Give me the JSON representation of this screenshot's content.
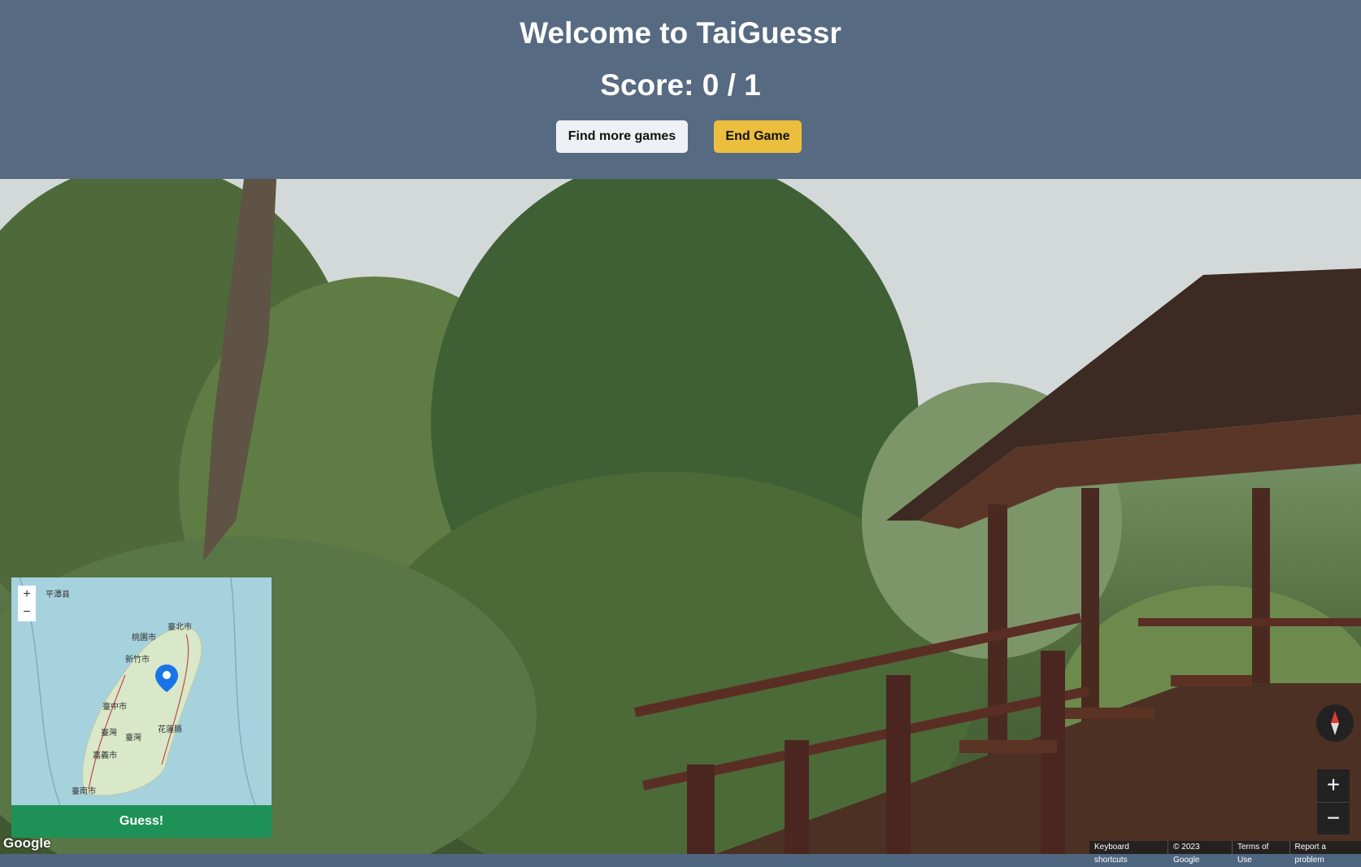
{
  "header": {
    "title": "Welcome to TaiGuessr",
    "score": "Score: 0 / 1",
    "find_more_label": "Find more games",
    "end_game_label": "End Game"
  },
  "minimap": {
    "zoom_in": "+",
    "zoom_out": "−",
    "guess_label": "Guess!",
    "labels": [
      "平潭县",
      "臺北市",
      "桃園市",
      "新竹市",
      "臺中市",
      "臺灣",
      "臺灣",
      "花蓮縣",
      "嘉義市",
      "臺南市"
    ]
  },
  "streetview": {
    "google_logo": "Google",
    "zoom_in": "+",
    "zoom_out": "−",
    "footer": [
      "Keyboard shortcuts",
      "© 2023 Google",
      "Terms of Use",
      "Report a problem"
    ]
  },
  "colors": {
    "header_bg": "#566a82",
    "end_game_bg": "#ebbe3e",
    "guess_bg": "#1e9256"
  }
}
